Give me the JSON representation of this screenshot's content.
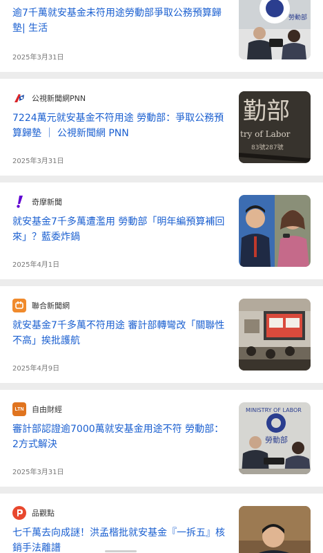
{
  "articles": [
    {
      "source": "",
      "headline": "逾7千萬就安基金未符用途勞動部爭取公務預算歸墊| 生活",
      "date": "2025年3月31日",
      "thumb_icon": "ministry-press-photo"
    },
    {
      "source": "公視新聞網PNN",
      "source_icon": "pnn-logo-icon",
      "headline": "7224萬元就安基金不符用途 勞動部：爭取公務預算歸墊 ｜ 公視新聞網 PNN",
      "date": "2025年3月31日",
      "thumb_icon": "ministry-sign-photo",
      "thumb_text": "try of Labor",
      "thumb_number": "83號287號"
    },
    {
      "source": "奇摩新聞",
      "source_icon": "yahoo-logo-icon",
      "headline": "就安基金7千多萬遭濫用 勞動部「明年編預算補回來」？藍委炸鍋",
      "date": "2025年4月1日",
      "thumb_icon": "legislators-photo"
    },
    {
      "source": "聯合新聞網",
      "source_icon": "udn-logo-icon",
      "headline": "就安基金7千多萬不符用途 審計部轉彎改「關聯性不高」挨批護航",
      "date": "2025年4月9日",
      "thumb_icon": "meeting-room-photo"
    },
    {
      "source": "自由財經",
      "source_icon": "ltn-logo-icon",
      "source_logo_text": "LTN",
      "headline": "審計部認證逾7000萬就安基金用途不符 勞動部：2方式解決",
      "date": "2025年3月31日",
      "thumb_icon": "ministry-press-photo",
      "thumb_text": "勞動部",
      "thumb_banner": "MINISTRY OF LABOR"
    },
    {
      "source": "品觀點",
      "source_icon": "pinview-logo-icon",
      "headline": "七千萬去向成謎！洪孟楷批就安基金『一拆五』核銷手法離譜",
      "date": "",
      "thumb_icon": "legislator-speaking-photo"
    }
  ],
  "colors": {
    "headline": "#1a5fd0",
    "separator": "#ececec",
    "date": "#777777"
  }
}
